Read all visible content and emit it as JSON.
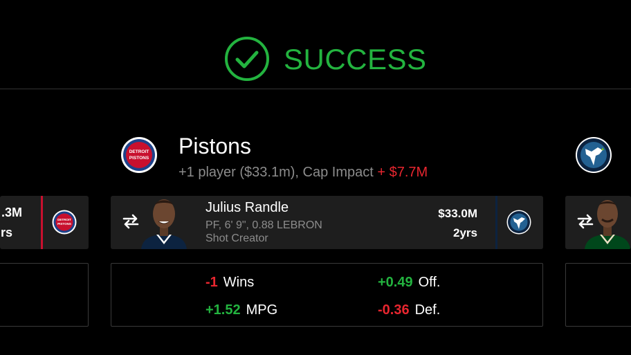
{
  "success": {
    "label": "SUCCESS",
    "color": "#23b33f"
  },
  "team": {
    "name": "Pistons",
    "summary_prefix": "+1 player ($33.1m), Cap Impact ",
    "impact": "+ $7.7M",
    "logo_text_1": "DETROIT",
    "logo_text_2": "PISTONS"
  },
  "left_card": {
    "salary": ".3M",
    "years": "rs"
  },
  "player": {
    "name": "Julius Randle",
    "details": "PF, 6' 9\", 0.88 LEBRON",
    "role": "Shot Creator",
    "salary": "$33.0M",
    "years": "2yrs"
  },
  "stats": {
    "wins": {
      "value": "-1",
      "label": "Wins"
    },
    "off": {
      "value": "+0.49",
      "label": "Off."
    },
    "mpg": {
      "value": "+1.52",
      "label": "MPG"
    },
    "def": {
      "value": "-0.36",
      "label": "Def."
    }
  },
  "icons": [
    "check-circle-icon",
    "swap-icon",
    "pistons-logo",
    "timberwolves-logo"
  ]
}
